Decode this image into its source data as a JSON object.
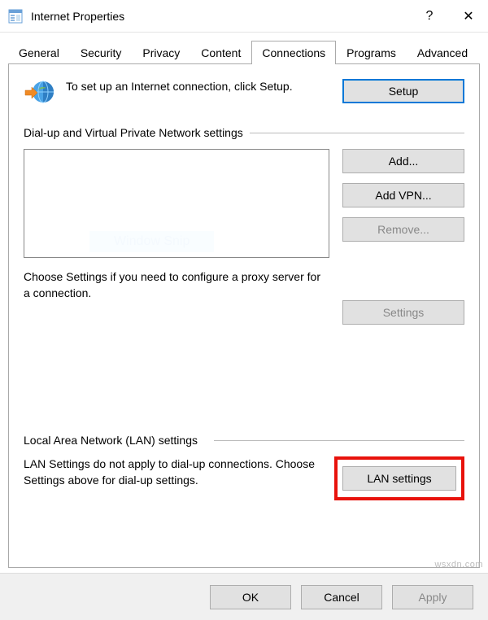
{
  "window": {
    "title": "Internet Properties",
    "help_symbol": "?",
    "close_symbol": "✕"
  },
  "tabs": {
    "items": [
      {
        "label": "General"
      },
      {
        "label": "Security"
      },
      {
        "label": "Privacy"
      },
      {
        "label": "Content"
      },
      {
        "label": "Connections"
      },
      {
        "label": "Programs"
      },
      {
        "label": "Advanced"
      }
    ],
    "active_index": 4
  },
  "intro": {
    "text": "To set up an Internet connection, click Setup.",
    "setup_label": "Setup"
  },
  "dialup": {
    "group_title": "Dial-up and Virtual Private Network settings",
    "add_label": "Add...",
    "add_vpn_label": "Add VPN...",
    "remove_label": "Remove...",
    "settings_label": "Settings",
    "choose_text": "Choose Settings if you need to configure a proxy server for a connection.",
    "ghost_text": "Window Snip"
  },
  "lan": {
    "group_title": "Local Area Network (LAN) settings",
    "description": "LAN Settings do not apply to dial-up connections. Choose Settings above for dial-up settings.",
    "button_label": "LAN settings"
  },
  "footer": {
    "ok": "OK",
    "cancel": "Cancel",
    "apply": "Apply"
  },
  "watermark": "wsxdn.com"
}
